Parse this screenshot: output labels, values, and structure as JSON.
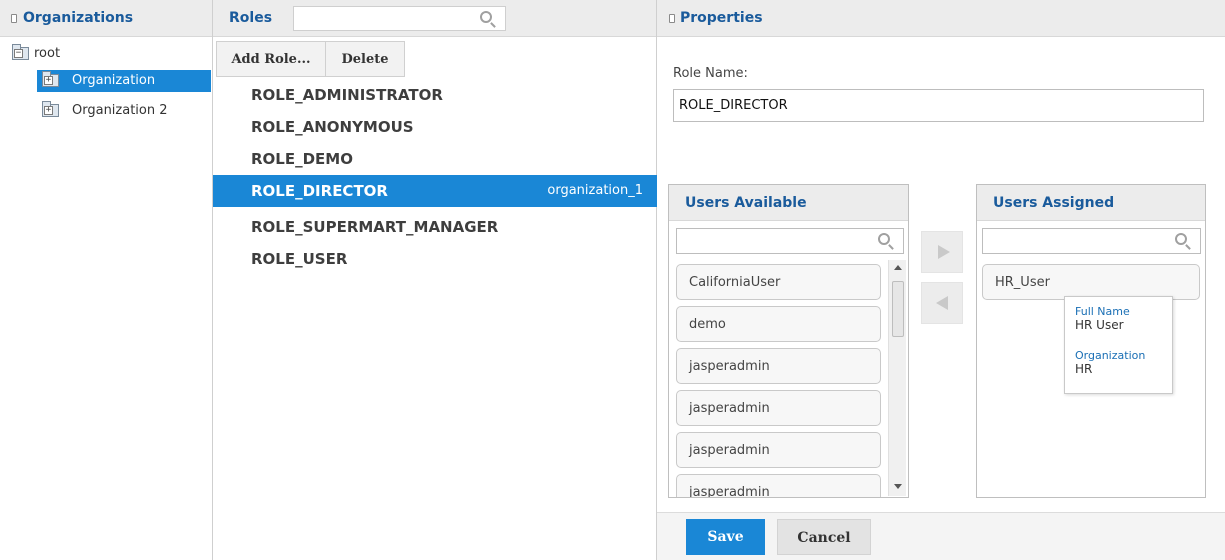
{
  "organizations": {
    "title": "Organizations",
    "tree": [
      {
        "label": "root",
        "sign": "−"
      },
      {
        "label": "Organization",
        "sign": "+"
      },
      {
        "label": "Organization 2",
        "sign": "+"
      }
    ]
  },
  "roles": {
    "title": "Roles",
    "search_placeholder": "",
    "toolbar": {
      "add_label": "Add Role...",
      "delete_label": "Delete"
    },
    "items": [
      {
        "name": "ROLE_ADMINISTRATOR",
        "org": ""
      },
      {
        "name": "ROLE_ANONYMOUS",
        "org": ""
      },
      {
        "name": "ROLE_DEMO",
        "org": ""
      },
      {
        "name": "ROLE_DIRECTOR",
        "org": "organization_1"
      },
      {
        "name": "ROLE_SUPERMART_MANAGER",
        "org": ""
      },
      {
        "name": "ROLE_USER",
        "org": ""
      }
    ],
    "selected_index": 3
  },
  "properties": {
    "title": "Properties",
    "role_name_label": "Role Name:",
    "role_name_value": "ROLE_DIRECTOR",
    "users_available": {
      "title": "Users Available",
      "search_value": "",
      "items": [
        "CaliforniaUser",
        "demo",
        "jasperadmin",
        "jasperadmin",
        "jasperadmin",
        "jasperadmin"
      ]
    },
    "users_assigned": {
      "title": "Users Assigned",
      "search_value": "",
      "items": [
        "HR_User"
      ]
    },
    "tooltip": {
      "full_name_label": "Full Name",
      "full_name_value": "HR User",
      "organization_label": "Organization",
      "organization_value": "HR"
    },
    "footer": {
      "save_label": "Save",
      "cancel_label": "Cancel"
    }
  },
  "colors": {
    "selection": "#1a87d6",
    "header_text": "#1a5b9c",
    "panel_header_bg": "#ececec"
  }
}
